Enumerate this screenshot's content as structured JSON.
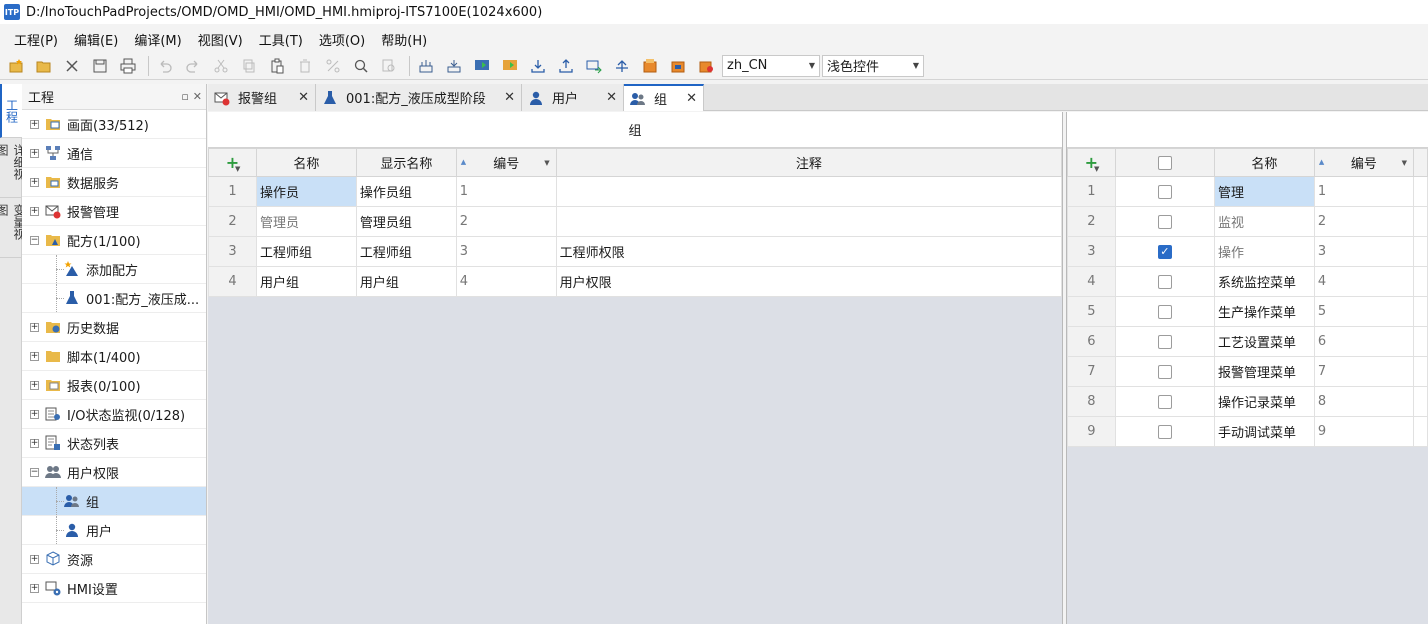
{
  "app": {
    "logo": "ITP",
    "title": "D:/InoTouchPadProjects/OMD/OMD_HMI/OMD_HMI.hmiproj-ITS7100E(1024x600)"
  },
  "menu": [
    "工程(P)",
    "编辑(E)",
    "编译(M)",
    "视图(V)",
    "工具(T)",
    "选项(O)",
    "帮助(H)"
  ],
  "toolbar": {
    "language": "zh_CN",
    "theme": "浅色控件"
  },
  "vtabs": [
    "工程",
    "详细视图",
    "变量视图"
  ],
  "tree": {
    "header": "工程",
    "items": [
      {
        "label": "画面(33/512)",
        "icon": "screen-folder-icon",
        "level": 0,
        "exp": "+"
      },
      {
        "label": "通信",
        "icon": "network-icon",
        "level": 0,
        "exp": "+"
      },
      {
        "label": "数据服务",
        "icon": "data-folder-icon",
        "level": 0,
        "exp": "+"
      },
      {
        "label": "报警管理",
        "icon": "alarm-icon",
        "level": 0,
        "exp": "+"
      },
      {
        "label": "配方(1/100)",
        "icon": "recipe-folder-icon",
        "level": 0,
        "exp": "−"
      },
      {
        "label": "添加配方",
        "icon": "add-recipe-icon",
        "level": 1
      },
      {
        "label": "001:配方_液压成...",
        "icon": "flask-icon",
        "level": 1
      },
      {
        "label": "历史数据",
        "icon": "history-folder-icon",
        "level": 0,
        "exp": "+"
      },
      {
        "label": "脚本(1/400)",
        "icon": "script-folder-icon",
        "level": 0,
        "exp": "+"
      },
      {
        "label": "报表(0/100)",
        "icon": "report-folder-icon",
        "level": 0,
        "exp": "+"
      },
      {
        "label": "I/O状态监视(0/128)",
        "icon": "io-monitor-icon",
        "level": 0,
        "exp": "+"
      },
      {
        "label": "状态列表",
        "icon": "status-list-icon",
        "level": 0,
        "exp": "+"
      },
      {
        "label": "用户权限",
        "icon": "users-icon",
        "level": 0,
        "exp": "−"
      },
      {
        "label": "组",
        "icon": "group-icon",
        "level": 1,
        "selected": true
      },
      {
        "label": "用户",
        "icon": "user-icon",
        "level": 1
      },
      {
        "label": "资源",
        "icon": "resource-icon",
        "level": 0,
        "exp": "+"
      },
      {
        "label": "HMI设置",
        "icon": "hmi-settings-icon",
        "level": 0,
        "exp": "+"
      }
    ]
  },
  "tabs": [
    {
      "label": "报警组",
      "icon": "alarm-icon"
    },
    {
      "label": "001:配方_液压成型阶段",
      "icon": "flask-icon"
    },
    {
      "label": "用户",
      "icon": "user-icon"
    },
    {
      "label": "组",
      "icon": "group-icon",
      "active": true
    }
  ],
  "group_panel": {
    "title": "组",
    "columns": [
      "名称",
      "显示名称",
      "编号",
      "注释"
    ],
    "rows": [
      {
        "num": "1",
        "name": "操作员",
        "display": "操作员组",
        "id": "1",
        "note": ""
      },
      {
        "num": "2",
        "name": "管理员",
        "display": "管理员组",
        "id": "2",
        "note": ""
      },
      {
        "num": "3",
        "name": "工程师组",
        "display": "工程师组",
        "id": "3",
        "note": "工程师权限"
      },
      {
        "num": "4",
        "name": "用户组",
        "display": "用户组",
        "id": "4",
        "note": "用户权限"
      }
    ]
  },
  "perm_panel": {
    "columns": [
      "名称",
      "编号"
    ],
    "rows": [
      {
        "num": "1",
        "checked": false,
        "name": "管理",
        "id": "1"
      },
      {
        "num": "2",
        "checked": false,
        "name": "监视",
        "id": "2"
      },
      {
        "num": "3",
        "checked": true,
        "name": "操作",
        "id": "3"
      },
      {
        "num": "4",
        "checked": false,
        "name": "系统监控菜单",
        "id": "4"
      },
      {
        "num": "5",
        "checked": false,
        "name": "生产操作菜单",
        "id": "5"
      },
      {
        "num": "6",
        "checked": false,
        "name": "工艺设置菜单",
        "id": "6"
      },
      {
        "num": "7",
        "checked": false,
        "name": "报警管理菜单",
        "id": "7"
      },
      {
        "num": "8",
        "checked": false,
        "name": "操作记录菜单",
        "id": "8"
      },
      {
        "num": "9",
        "checked": false,
        "name": "手动调试菜单",
        "id": "9"
      }
    ]
  }
}
